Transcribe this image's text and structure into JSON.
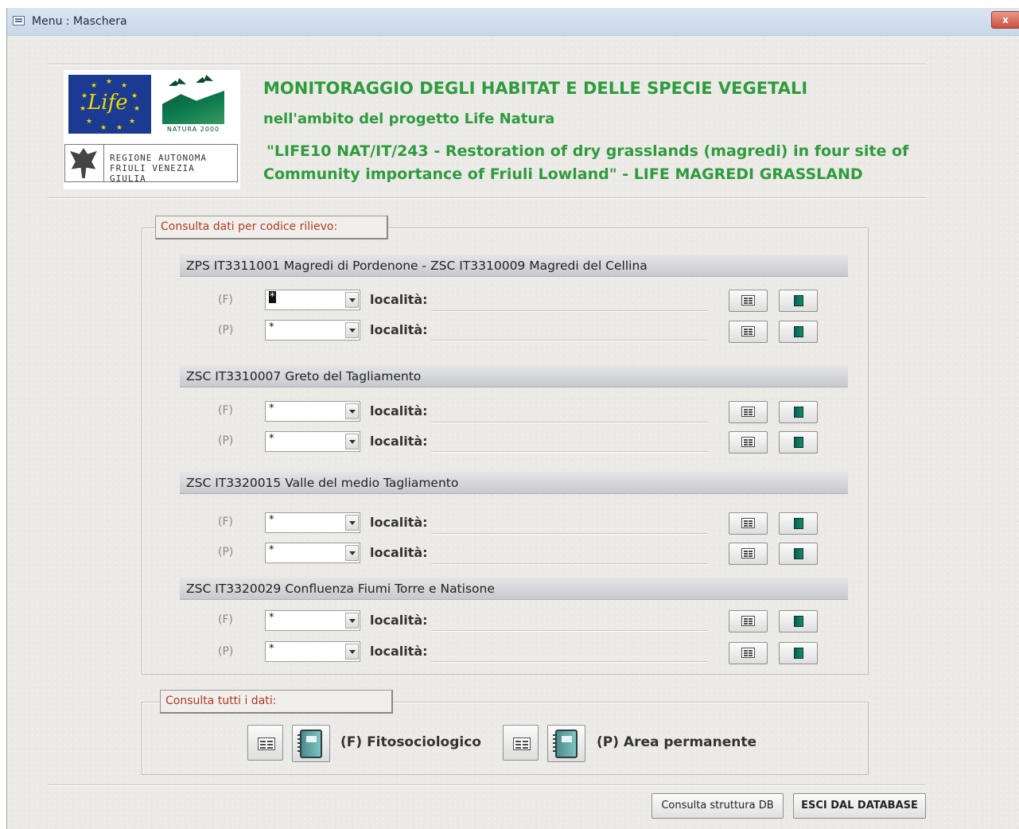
{
  "window": {
    "title": "Menu : Maschera",
    "close_label": "x"
  },
  "logos": {
    "life_text": "Life",
    "natura_text": "NATURA 2000",
    "regione_line1": "REGIONE AUTONOMA",
    "regione_line2": "FRIULI VENEZIA GIULIA"
  },
  "header": {
    "line1": "MONITORAGGIO DEGLI HABITAT E DELLE SPECIE VEGETALI",
    "line2": "nell'ambito del progetto Life Natura",
    "line3": "\"LIFE10 NAT/IT/243 - Restoration of dry grasslands (magredi) in four site of",
    "line4": "Community importance of Friuli Lowland\" - LIFE MAGREDI GRASSLAND"
  },
  "consulta_codice": {
    "label": "Consulta dati per codice rilievo:",
    "loc_label": "località:",
    "sites": [
      {
        "name": "ZPS IT3311001 Magredi di Pordenone - ZSC IT3310009 Magredi del Cellina",
        "rows": [
          {
            "code": "(F)",
            "value": "*"
          },
          {
            "code": "(P)",
            "value": "*"
          }
        ]
      },
      {
        "name": "ZSC IT3310007 Greto del Tagliamento",
        "rows": [
          {
            "code": "(F)",
            "value": "*"
          },
          {
            "code": "(P)",
            "value": "*"
          }
        ]
      },
      {
        "name": "ZSC IT3320015 Valle del medio Tagliamento",
        "rows": [
          {
            "code": "(F)",
            "value": "*"
          },
          {
            "code": "(P)",
            "value": "*"
          }
        ]
      },
      {
        "name": "ZSC IT3320029 Confluenza Fiumi Torre e Natisone",
        "rows": [
          {
            "code": "(F)",
            "value": "*"
          },
          {
            "code": "(P)",
            "value": "*"
          }
        ]
      }
    ],
    "icons": {
      "form": "form-view-icon",
      "report": "report-book-icon"
    }
  },
  "consulta_tutti": {
    "label": "Consulta tutti i dati:",
    "fitosociologico_label": "(F) Fitosociologico",
    "area_label": "(P) Area permanente"
  },
  "footer": {
    "struttura_label": "Consulta struttura DB",
    "esci_label": "ESCI DAL DATABASE"
  }
}
